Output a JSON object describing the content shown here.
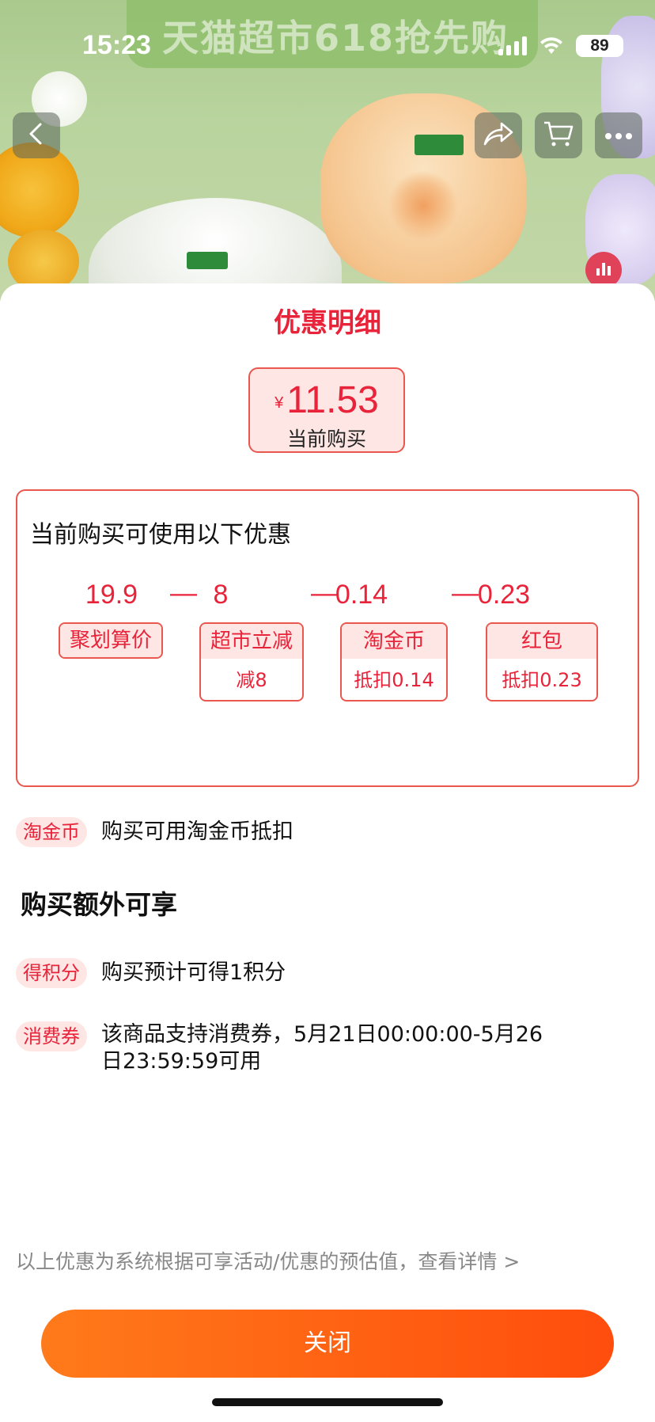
{
  "hero": {
    "banner_text": "天猫超市618抢先购"
  },
  "status_bar": {
    "time": "15:23",
    "battery": "89"
  },
  "sheet": {
    "title": "优惠明细",
    "price": {
      "currency_symbol": "¥",
      "value": "11.53",
      "caption": "当前购买"
    },
    "discounts": {
      "heading": "当前购买可使用以下优惠",
      "calc": {
        "items": [
          "19.9",
          "8",
          "0.14",
          "0.23"
        ],
        "operator": "—"
      },
      "tags": [
        {
          "label": "聚划算价",
          "sub": ""
        },
        {
          "label": "超市立减",
          "sub": "减8"
        },
        {
          "label": "淘金币",
          "sub": "抵扣0.14"
        },
        {
          "label": "红包",
          "sub": "抵扣0.23"
        }
      ]
    },
    "taojinbi_row": {
      "badge": "淘金币",
      "text": "购买可用淘金币抵扣"
    },
    "extra": {
      "title": "购买额外可享",
      "rows": [
        {
          "badge": "得积分",
          "text": "购买预计可得1积分"
        },
        {
          "badge": "消费券",
          "text": "该商品支持消费券，5月21日00:00:00-5月26日23:59:59可用"
        }
      ]
    },
    "footnote": "以上优惠为系统根据可享活动/优惠的预估值，查看详情 >",
    "close_label": "关闭"
  },
  "colors": {
    "accent_red": "#e8233a",
    "tag_bg": "#fde6e3",
    "button_gradient_start": "#ff7a1a",
    "button_gradient_end": "#ff4d0d"
  },
  "icons": {
    "back": "chevron-left-icon",
    "share": "share-icon",
    "cart": "cart-icon",
    "more": "more-icon",
    "side": "chart-icon"
  }
}
